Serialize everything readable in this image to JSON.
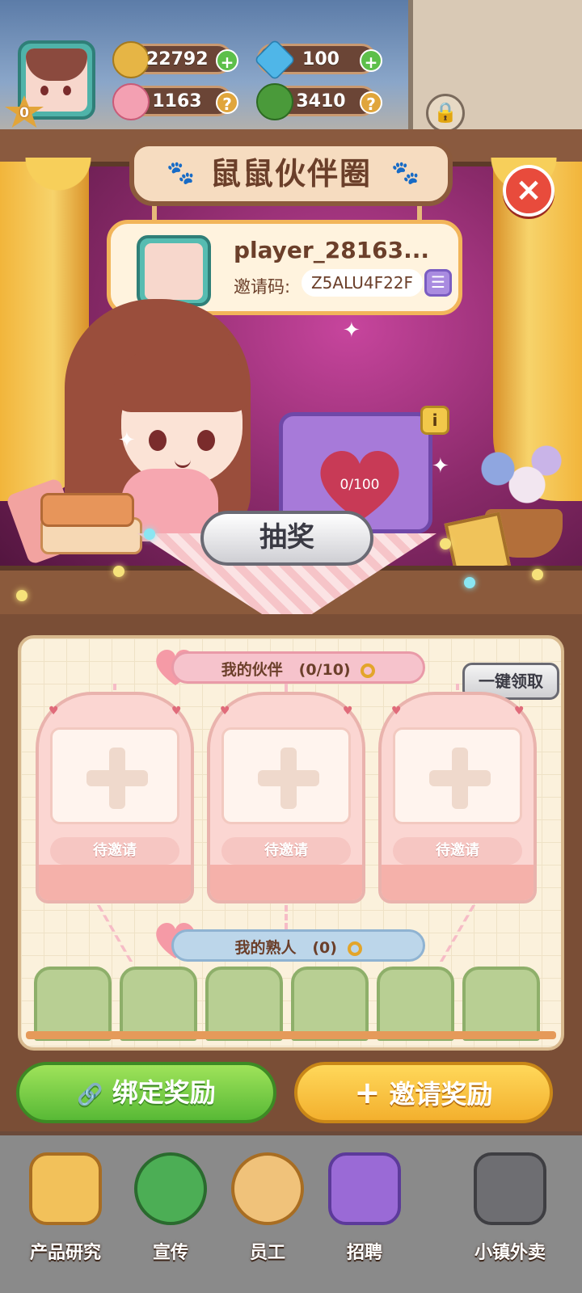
{
  "resources": {
    "level": "0",
    "seeds": "22792",
    "gems": "100",
    "flowers": "1163",
    "clovers": "3410",
    "plus_symbol": "+",
    "help_symbol": "?"
  },
  "panel": {
    "title": "鼠鼠伙伴圈",
    "close_symbol": "×"
  },
  "player": {
    "name": "player_28163...",
    "invite_label": "邀请码:",
    "invite_code": "Z5ALU4F22F",
    "copy_symbol": "☰"
  },
  "chest": {
    "progress_text": "0/100",
    "info_symbol": "i",
    "draw_label": "抽奖"
  },
  "partners": {
    "section_label": "我的伙伴",
    "count_text": "(0/10)",
    "claim_all_label": "一键领取",
    "slots": [
      {
        "status": "待邀请"
      },
      {
        "status": "待邀请"
      },
      {
        "status": "待邀请"
      }
    ]
  },
  "acquaintances": {
    "section_label": "我的熟人",
    "count_text": "(0)"
  },
  "actions": {
    "bind_reward": "绑定奖励",
    "invite_reward": "邀请奖励",
    "link_symbol": "🔗",
    "plus_symbol": "+"
  },
  "bottom_nav": {
    "items": [
      {
        "label": "产品研究",
        "icon": "research-icon"
      },
      {
        "label": "宣传",
        "icon": "megaphone-icon"
      },
      {
        "label": "员工",
        "icon": "hamster-icon"
      },
      {
        "label": "招聘",
        "icon": "recruit-icon"
      },
      {
        "label": "小镇外卖",
        "icon": "locked-delivery-icon"
      }
    ]
  },
  "colors": {
    "green_button": "#58b936",
    "yellow_button": "#f3b02e",
    "close_red": "#e84b3c",
    "accent_teal": "#4fb3a9"
  }
}
